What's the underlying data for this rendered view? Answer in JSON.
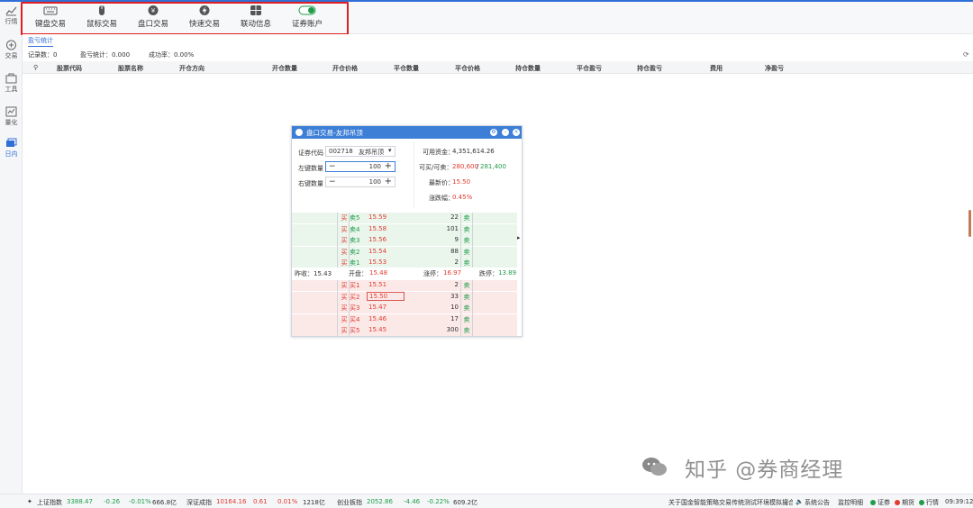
{
  "sidebar": {
    "items": [
      {
        "label": "行情"
      },
      {
        "label": "交易"
      },
      {
        "label": "工具"
      },
      {
        "label": "量化"
      },
      {
        "label": "日内"
      }
    ]
  },
  "toolbar": {
    "buttons": [
      {
        "label": "键盘交易",
        "icon": "keyboard-icon"
      },
      {
        "label": "鼠标交易",
        "icon": "mouse-icon"
      },
      {
        "label": "盘口交易",
        "icon": "yen-icon"
      },
      {
        "label": "快速交易",
        "icon": "lightning-icon"
      },
      {
        "label": "联动信息",
        "icon": "link-icon"
      },
      {
        "label": "证券账户",
        "icon": "toggle-icon"
      }
    ]
  },
  "tab": {
    "label": "盈亏统计"
  },
  "stats": {
    "records": "记录数：0",
    "profit": "盈亏统计：0.000",
    "success": "成功率：0.00%"
  },
  "table": {
    "headers": [
      "股票代码",
      "股票名称",
      "开仓方向",
      "开仓数量",
      "开仓价格",
      "平仓数量",
      "平仓价格",
      "持仓数量",
      "平仓盈亏",
      "持仓盈亏",
      "费用",
      "净盈亏"
    ]
  },
  "dialog": {
    "title": "盘口交易-友邦吊顶",
    "code_label": "证券代码",
    "code_value": "002718",
    "code_name": "友邦吊顶",
    "left_qty_label": "左键数量",
    "left_qty": "100",
    "right_qty_label": "右键数量",
    "right_qty": "100",
    "available_label": "可用资金：",
    "available_value": "4,351,614.26",
    "buysell_label": "可买/可卖：",
    "can_buy": "280,600",
    "slash": "/",
    "can_sell": "281,400",
    "last_label": "最新价：",
    "last_value": "15.50",
    "change_label": "涨跌幅：",
    "change_value": "0.45%",
    "buy_char": "买",
    "sell_char": "卖",
    "asks": [
      {
        "level": "卖5",
        "price": "15.59",
        "vol": "22"
      },
      {
        "level": "卖4",
        "price": "15.58",
        "vol": "101"
      },
      {
        "level": "卖3",
        "price": "15.56",
        "vol": "9"
      },
      {
        "level": "卖2",
        "price": "15.54",
        "vol": "88"
      },
      {
        "level": "卖1",
        "price": "15.53",
        "vol": "2"
      }
    ],
    "mid": {
      "prev_close": "昨收：15.43",
      "open_label": "开盘：",
      "open_value": "15.48",
      "limit_up_label": "涨停：",
      "limit_up_value": "16.97",
      "limit_down_label": "跌停：",
      "limit_down_value": "13.89"
    },
    "bids": [
      {
        "level": "买1",
        "price": "15.51",
        "vol": "2"
      },
      {
        "level": "买2",
        "price": "15.50",
        "vol": "33"
      },
      {
        "level": "买3",
        "price": "15.47",
        "vol": "10"
      },
      {
        "level": "买4",
        "price": "15.46",
        "vol": "17"
      },
      {
        "level": "买5",
        "price": "15.45",
        "vol": "300"
      }
    ]
  },
  "watermark": "知乎 @券商经理",
  "statusbar": {
    "sh_label": "上证指数",
    "sh_value": "3388.47",
    "sh_change": "-0.26",
    "sh_pct": "-0.01%",
    "sh_amount": "666.8亿",
    "sz_label": "深证成指",
    "sz_value": "10164.16",
    "sz_change": "0.61",
    "sz_pct": "0.01%",
    "sz_amount": "1218亿",
    "cy_label": "创业板指",
    "cy_value": "2052.86",
    "cy_change": "-4.46",
    "cy_pct": "-0.22%",
    "cy_amount": "609.2亿",
    "notice": "关于国金智能策略交易传统测试环境模拟撮合",
    "announce": "系统公告",
    "monitor": "监控明细",
    "sec": "证券",
    "futures": "期货",
    "quote": "行情",
    "time": "09:39:12"
  },
  "colors": {
    "accent": "#2f6fd6",
    "up": "#e23b2f",
    "down": "#1f9d4a",
    "highlight": "#e02020"
  }
}
